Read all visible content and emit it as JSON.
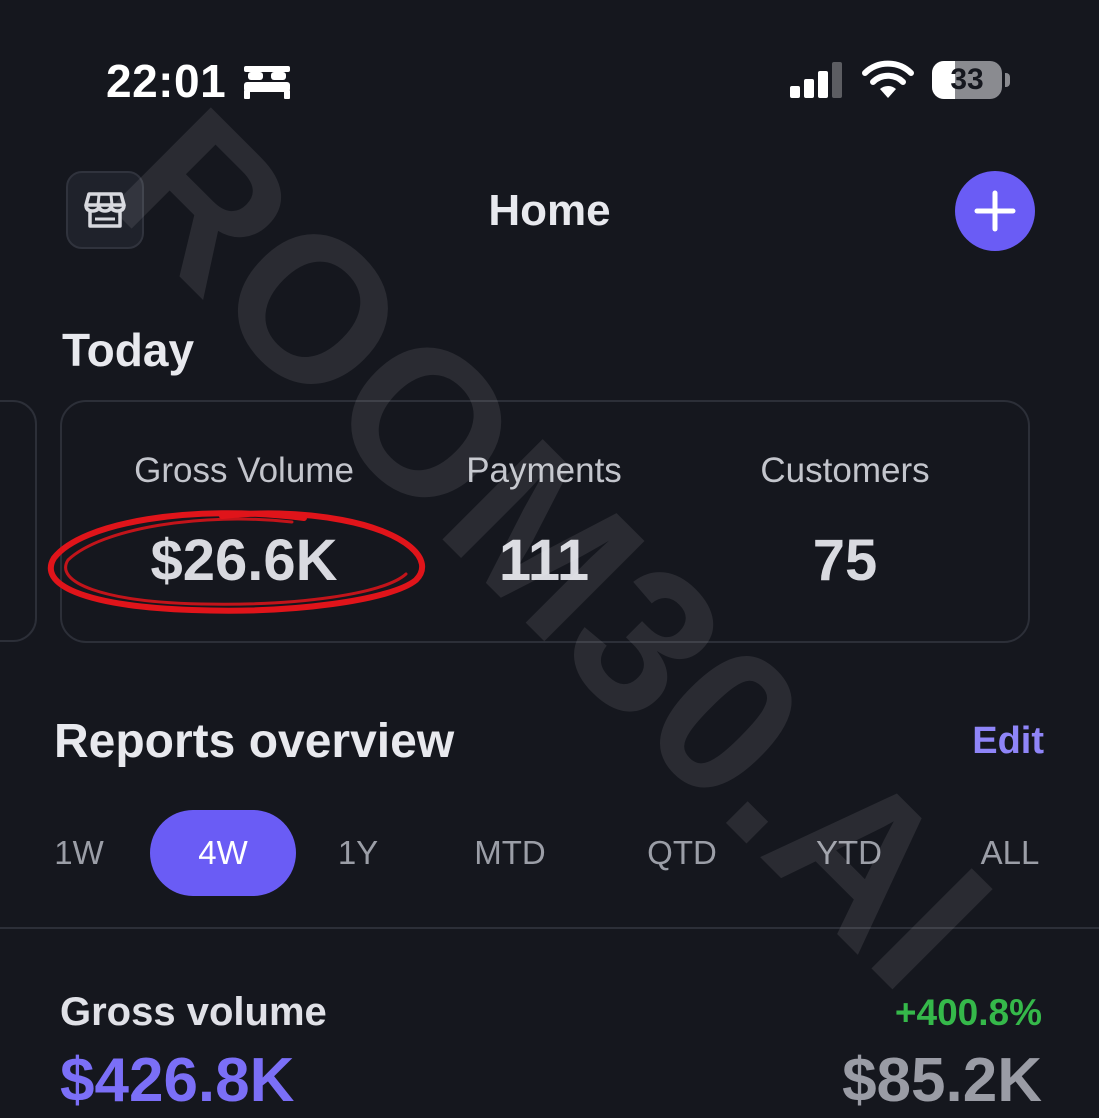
{
  "status_bar": {
    "time": "22:01",
    "focus_icon": "bed-icon",
    "battery_level": "33",
    "battery_fraction": 0.33
  },
  "header": {
    "title": "Home",
    "store_icon": "storefront-icon",
    "add_icon": "plus-icon"
  },
  "today": {
    "title": "Today",
    "metrics": [
      {
        "label": "Gross Volume",
        "value": "$26.6K"
      },
      {
        "label": "Payments",
        "value": "111"
      },
      {
        "label": "Customers",
        "value": "75"
      }
    ]
  },
  "reports": {
    "title": "Reports overview",
    "edit_label": "Edit",
    "ranges": [
      "1W",
      "4W",
      "1Y",
      "MTD",
      "QTD",
      "YTD",
      "ALL"
    ],
    "active_range": "4W"
  },
  "gross_volume": {
    "title": "Gross volume",
    "change": "+400.8%",
    "value": "$426.8K",
    "previous_value": "$85.2K"
  },
  "watermark": {
    "text": "ROOM30.AI"
  },
  "colors": {
    "background": "#15171e",
    "accent": "#6a5cf5",
    "positive": "#35b84a",
    "annotation": "#e0141a"
  }
}
